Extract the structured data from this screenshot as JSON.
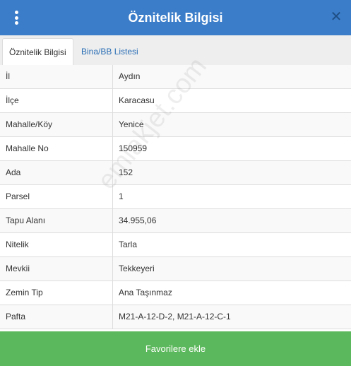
{
  "header": {
    "title": "Öznitelik Bilgisi",
    "close_glyph": "✕"
  },
  "tabs": [
    {
      "label": "Öznitelik Bilgisi",
      "active": true
    },
    {
      "label": "Bina/BB Listesi",
      "active": false
    }
  ],
  "attributes": [
    {
      "key": "İl",
      "value": "Aydın"
    },
    {
      "key": "İlçe",
      "value": "Karacasu"
    },
    {
      "key": "Mahalle/Köy",
      "value": "Yenice"
    },
    {
      "key": "Mahalle No",
      "value": "150959"
    },
    {
      "key": "Ada",
      "value": "152"
    },
    {
      "key": "Parsel",
      "value": "1"
    },
    {
      "key": "Tapu Alanı",
      "value": "34.955,06"
    },
    {
      "key": "Nitelik",
      "value": "Tarla"
    },
    {
      "key": "Mevkii",
      "value": "Tekkeyeri"
    },
    {
      "key": "Zemin Tip",
      "value": "Ana Taşınmaz"
    },
    {
      "key": "Pafta",
      "value": "M21-A-12-D-2, M21-A-12-C-1"
    }
  ],
  "watermark": "emlakjet.com",
  "footer": {
    "favorite_label": "Favorilere ekle"
  },
  "colors": {
    "header_bg": "#3b7dc9",
    "button_bg": "#5cb85c",
    "link": "#2a6eb5"
  },
  "icons": {
    "menu": "vertical-dots-icon",
    "close": "close-icon"
  }
}
